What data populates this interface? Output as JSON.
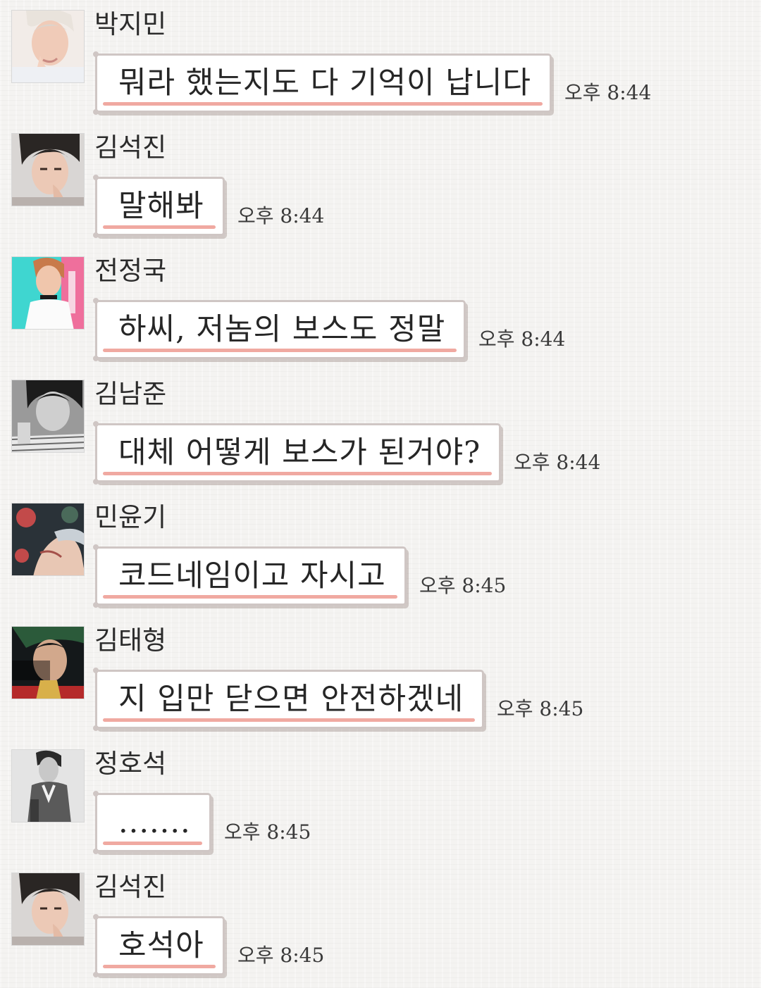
{
  "colors": {
    "background": "#f4f3f1",
    "bubble_border": "#cfc6c4",
    "bubble_underline": "#f0a9a1",
    "text": "#262626"
  },
  "messages": [
    {
      "sender": "박지민",
      "text": "뭐라 했는지도 다 기억이 납니다",
      "time": "오후 8:44",
      "avatar_icon": "jimin-avatar"
    },
    {
      "sender": "김석진",
      "text": "말해봐",
      "time": "오후 8:44",
      "avatar_icon": "seokjin-avatar"
    },
    {
      "sender": "전정국",
      "text": "하씨, 저놈의 보스도 정말",
      "time": "오후 8:44",
      "avatar_icon": "jungkook-avatar"
    },
    {
      "sender": "김남준",
      "text": "대체 어떻게 보스가 된거야?",
      "time": "오후 8:44",
      "avatar_icon": "namjoon-avatar"
    },
    {
      "sender": "민윤기",
      "text": "코드네임이고 자시고",
      "time": "오후 8:45",
      "avatar_icon": "yoongi-avatar"
    },
    {
      "sender": "김태형",
      "text": "지 입만 닫으면 안전하겠네",
      "time": "오후 8:45",
      "avatar_icon": "taehyung-avatar"
    },
    {
      "sender": "정호석",
      "text": ".......",
      "time": "오후 8:45",
      "avatar_icon": "hoseok-avatar"
    },
    {
      "sender": "김석진",
      "text": "호석아",
      "time": "오후 8:45",
      "avatar_icon": "seokjin-avatar"
    }
  ]
}
